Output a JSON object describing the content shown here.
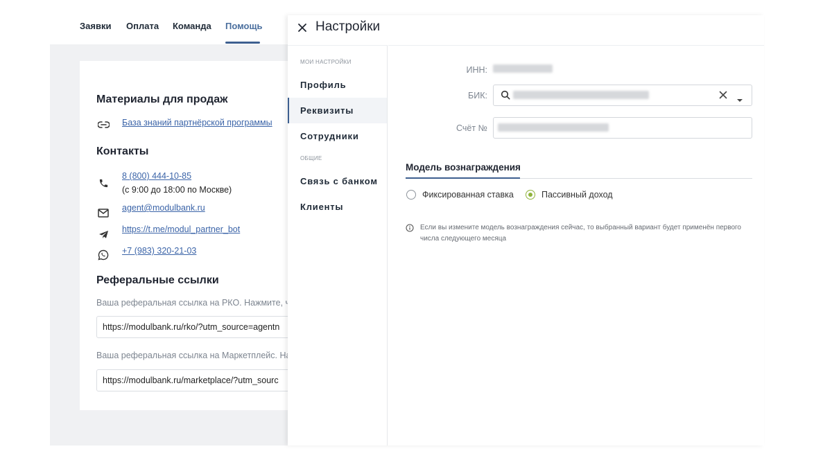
{
  "topnav": {
    "tabs": [
      {
        "label": "Заявки"
      },
      {
        "label": "Оплата"
      },
      {
        "label": "Команда"
      },
      {
        "label": "Помощь",
        "active": true
      }
    ]
  },
  "help": {
    "materials_title": "Материалы для продаж",
    "knowledge_link": "База знаний партнёрской программы",
    "contacts_title": "Контакты",
    "phone": "8 (800) 444-10-85",
    "phone_hours": "(с 9:00 до 18:00 по Москве)",
    "email": "agent@modulbank.ru",
    "telegram": "https://t.me/modul_partner_bot",
    "whatsapp": "+7 (983) 320-21-03",
    "referral_title": "Реферальные ссылки",
    "rko_hint": "Ваша реферальная ссылка на РКО. Нажмите, чт",
    "rko_link": "https://modulbank.ru/rko/?utm_source=agentn",
    "market_hint": "Ваша реферальная ссылка на Маркетплейс. На",
    "market_link": "https://modulbank.ru/marketplace/?utm_sourc"
  },
  "drawer": {
    "title": "Настройки",
    "sidebar": {
      "caption_my": "Мои настройки",
      "caption_common": "Общие",
      "items": [
        {
          "label": "Профиль"
        },
        {
          "label": "Реквизиты",
          "active": true
        },
        {
          "label": "Сотрудники"
        },
        {
          "label": "Связь с банком"
        },
        {
          "label": "Клиенты"
        }
      ]
    },
    "form": {
      "inn_label": "ИНН:",
      "bik_label": "БИК:",
      "account_label": "Счёт №"
    },
    "reward": {
      "title": "Модель вознаграждения",
      "options": [
        {
          "label": "Фиксированная ставка",
          "selected": false
        },
        {
          "label": "Пассивный доход",
          "selected": true
        }
      ],
      "note": "Если вы измените модель вознаграждения сейчас, то выбранный вариант будет применён первого числа следующего месяца"
    }
  },
  "colors": {
    "accent": "#3d5f8f",
    "radio_selected": "#8fb33b",
    "link": "#3b64a8"
  }
}
